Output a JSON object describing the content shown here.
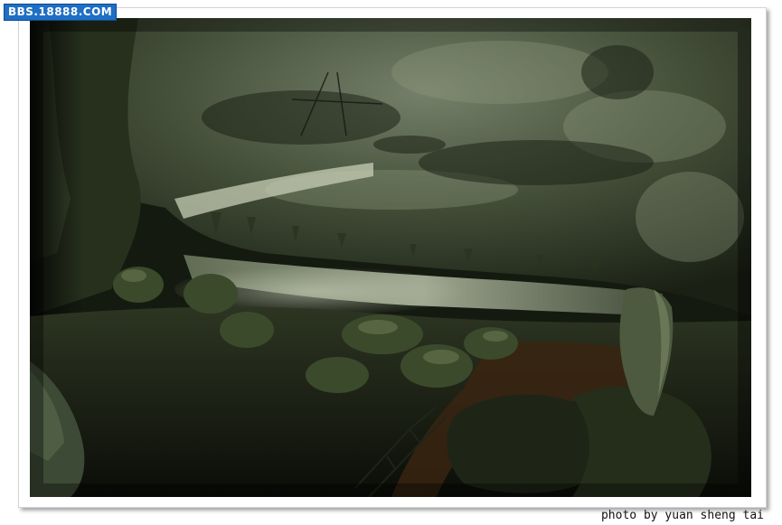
{
  "watermark": {
    "text": "BBS.18888.COM"
  },
  "credit": {
    "text": "photo by yuan sheng tai"
  },
  "colors": {
    "frame_background": "#ffffff",
    "watermark_background": "#1f6fc4",
    "photo_dominant": "#2a3320"
  }
}
